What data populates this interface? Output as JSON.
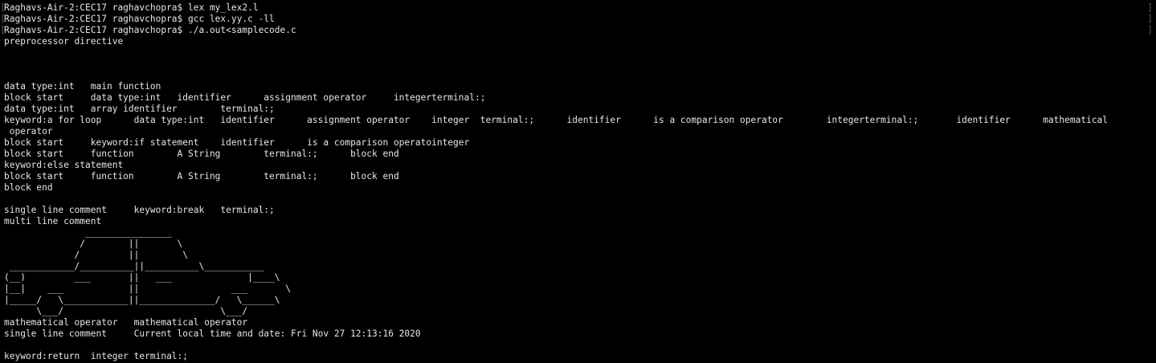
{
  "terminal": {
    "prompt_brackets": {
      "left": "[",
      "right": "]"
    },
    "lines": [
      "Raghavs-Air-2:CEC17 raghavchopra$ lex my_lex2.l",
      "Raghavs-Air-2:CEC17 raghavchopra$ gcc lex.yy.c -ll",
      "Raghavs-Air-2:CEC17 raghavchopra$ ./a.out<samplecode.c",
      "preprocessor directive",
      "",
      "",
      "",
      "data type:int   main function",
      "block start     data type:int   identifier      assignment operator     integerterminal:;",
      "data type:int   array identifier        terminal:;",
      "keyword:a for loop      data type:int   identifier      assignment operator    integer  terminal:;      identifier      is a comparison operator        integerterminal:;       identifier      mathematical",
      " operator",
      "block start     keyword:if statement    identifier      is a comparison operatointeger",
      "block start     function        A String        terminal:;      block end",
      "keyword:else statement",
      "block start     function        A String        terminal:;      block end",
      "block end",
      "",
      "single line comment     keyword:break   terminal:;",
      "multi line comment",
      "               ________________",
      "              /        ||       \\",
      "             /         ||        \\",
      " ____________/__________||__________\\___________",
      "(__)         ___       ||   ___              |____\\",
      "|__|    ___            ||                 ___       \\",
      "|_____/   \\____________||______________/   \\______\\",
      "      \\___/                             \\___/",
      "mathematical operator   mathematical operator",
      "single line comment     Current local time and date: Fri Nov 27 12:13:16 2020",
      "",
      "keyword:return  integer terminal:;"
    ]
  }
}
